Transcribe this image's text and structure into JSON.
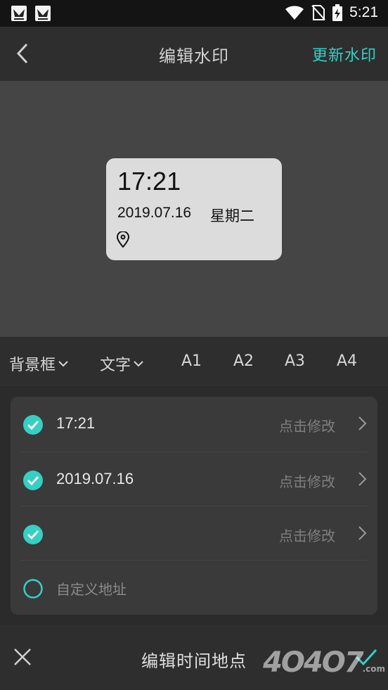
{
  "status_bar": {
    "time": "5:21",
    "icons": [
      "notification-icon",
      "notification-icon",
      "wifi-icon",
      "no-sim-icon",
      "battery-charging-icon"
    ]
  },
  "header": {
    "title": "编辑水印",
    "update_label": "更新水印",
    "back_icon": "back-arrow-icon"
  },
  "preview": {
    "time": "17:21",
    "date": "2019.07.16",
    "weekday": "星期二",
    "location_icon": "location-pin-icon"
  },
  "tabs": [
    {
      "label": "背景框"
    },
    {
      "label": "文字"
    },
    {
      "label": "A1"
    },
    {
      "label": "A2"
    },
    {
      "label": "A3"
    },
    {
      "label": "A4"
    }
  ],
  "rows": [
    {
      "text": "17:21",
      "checked": true,
      "action": "点击修改"
    },
    {
      "text": "2019.07.16",
      "checked": true,
      "action": "点击修改"
    },
    {
      "text": "",
      "checked": true,
      "action": "点击修改"
    },
    {
      "text": "自定义地址",
      "checked": false,
      "action": ""
    }
  ],
  "bottom_bar": {
    "title": "编辑时间地点",
    "close_icon": "close-icon",
    "confirm_icon": "check-icon"
  },
  "logo_watermark": "4O4O7.com",
  "colors": {
    "accent": "#35d0c4",
    "background": "#2b2b2b",
    "preview_bg": "#454545",
    "card_bg": "#dcdcdc"
  }
}
